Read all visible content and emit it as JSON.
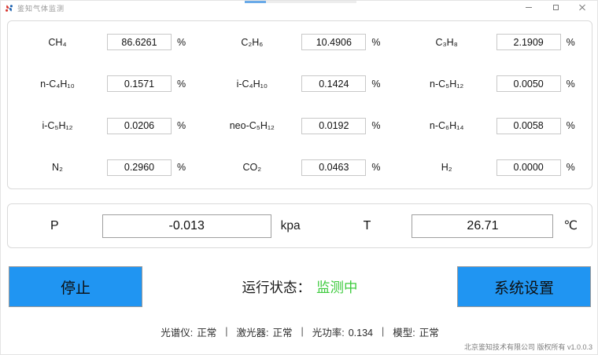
{
  "window": {
    "title": "鉴知气体监测"
  },
  "gases": {
    "unit": "%",
    "items": [
      {
        "label": "CH₄",
        "value": "86.6261"
      },
      {
        "label": "C₂H₆",
        "value": "10.4906"
      },
      {
        "label": "C₃H₈",
        "value": "2.1909"
      },
      {
        "label": "n-C₄H₁₀",
        "value": "0.1571"
      },
      {
        "label": "i-C₄H₁₀",
        "value": "0.1424"
      },
      {
        "label": "n-C₅H₁₂",
        "value": "0.0050"
      },
      {
        "label": "i-C₅H₁₂",
        "value": "0.0206"
      },
      {
        "label": "neo-C₅H₁₂",
        "value": "0.0192"
      },
      {
        "label": "n-C₆H₁₄",
        "value": "0.0058"
      },
      {
        "label": "N₂",
        "value": "0.2960"
      },
      {
        "label": "CO₂",
        "value": "0.0463"
      },
      {
        "label": "H₂",
        "value": "0.0000"
      }
    ]
  },
  "environment": {
    "pressure": {
      "label": "P",
      "value": "-0.013",
      "unit": "kpa"
    },
    "temperature": {
      "label": "T",
      "value": "26.71",
      "unit": "℃"
    }
  },
  "controls": {
    "stop_label": "停止",
    "settings_label": "系统设置",
    "run_status_label": "运行状态：",
    "run_status_value": "监测中"
  },
  "status_bar": {
    "separator": "|",
    "items": [
      {
        "label": "光谱仪:",
        "value": "正常"
      },
      {
        "label": "激光器:",
        "value": "正常"
      },
      {
        "label": "光功率:",
        "value": "0.134"
      },
      {
        "label": "模型:",
        "value": "正常"
      }
    ]
  },
  "footer": {
    "copyright": "北京鉴知技术有限公司 版权所有 v1.0.0.3"
  },
  "colors": {
    "accent": "#2095f2",
    "status_ok": "#3ecb3e",
    "scroll_thumb": "#6aaae8"
  }
}
